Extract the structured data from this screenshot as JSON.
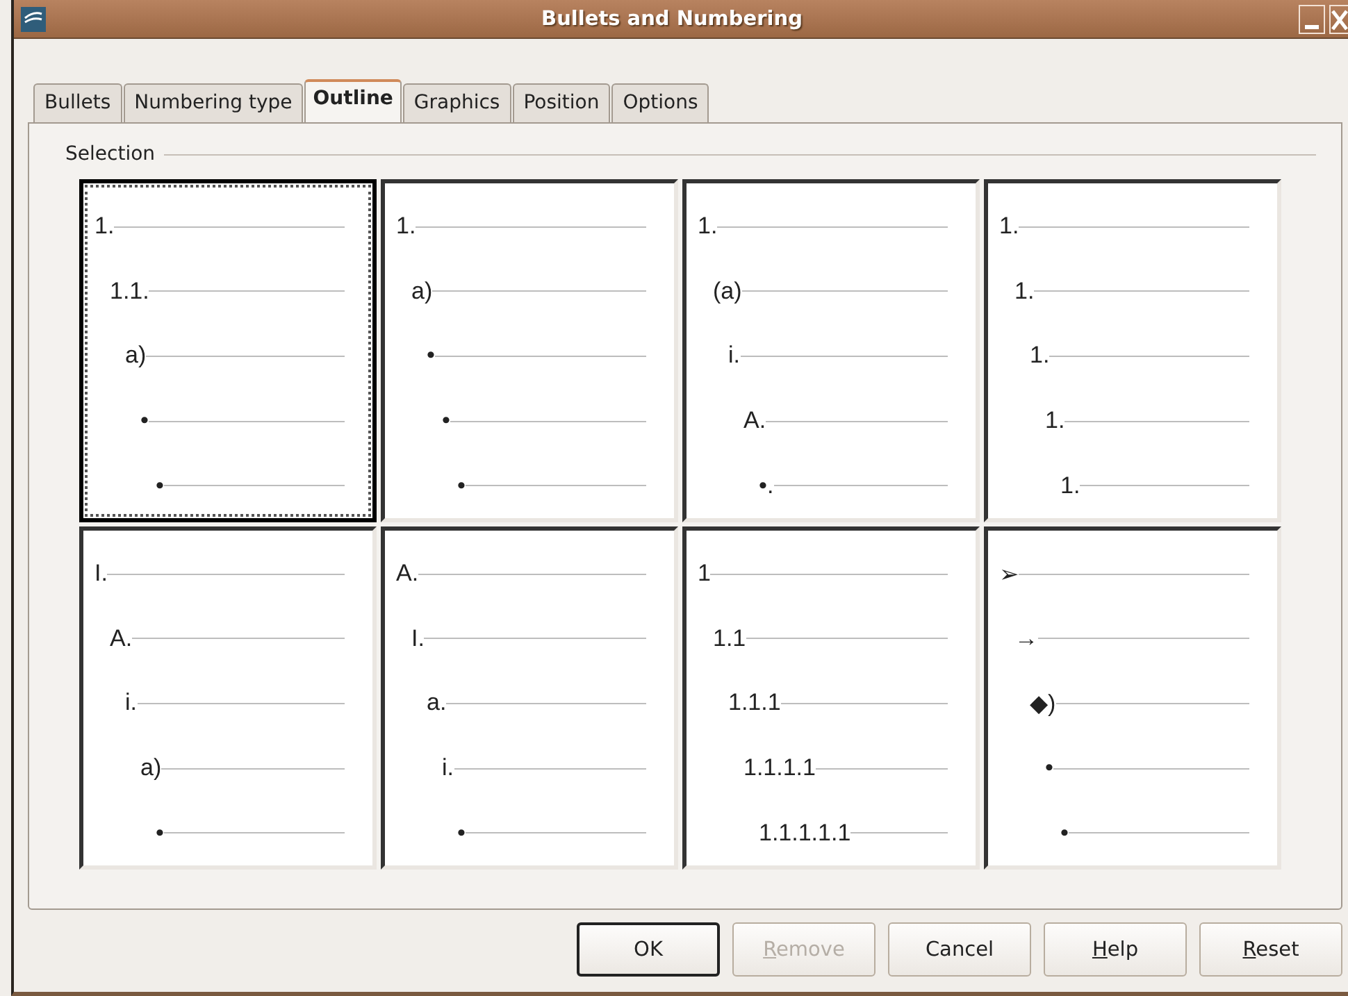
{
  "window": {
    "title": "Bullets and Numbering"
  },
  "tabs": [
    {
      "label": "Bullets",
      "selected": false
    },
    {
      "label": "Numbering type",
      "selected": false
    },
    {
      "label": "Outline",
      "selected": true
    },
    {
      "label": "Graphics",
      "selected": false
    },
    {
      "label": "Position",
      "selected": false
    },
    {
      "label": "Options",
      "selected": false
    }
  ],
  "selection": {
    "label": "Selection",
    "previews": [
      {
        "selected": true,
        "levels": [
          "1.",
          "1.1.",
          "a)",
          "•",
          "•"
        ]
      },
      {
        "selected": false,
        "levels": [
          "1.",
          "a)",
          "•",
          "•",
          "•"
        ]
      },
      {
        "selected": false,
        "levels": [
          "1.",
          "(a)",
          "i.",
          "A.",
          "•."
        ]
      },
      {
        "selected": false,
        "levels": [
          "1.",
          "1.",
          "1.",
          "1.",
          "1."
        ]
      },
      {
        "selected": false,
        "levels": [
          "I.",
          "A.",
          "i.",
          "a)",
          "•"
        ]
      },
      {
        "selected": false,
        "levels": [
          "A.",
          "I.",
          "a.",
          "i.",
          "•"
        ]
      },
      {
        "selected": false,
        "levels": [
          "1",
          "1.1",
          "1.1.1",
          "1.1.1.1",
          "1.1.1.1.1"
        ]
      },
      {
        "selected": false,
        "levels": [
          "➢",
          "→",
          "◆)",
          "•",
          "•"
        ]
      }
    ]
  },
  "buttons": [
    {
      "label": "OK",
      "mnemonic": false,
      "disabled": false,
      "default": true
    },
    {
      "label": "Remove",
      "mnemonic": true,
      "disabled": true,
      "default": false
    },
    {
      "label": "Cancel",
      "mnemonic": false,
      "disabled": false,
      "default": false
    },
    {
      "label": "Help",
      "mnemonic": true,
      "disabled": false,
      "default": false
    },
    {
      "label": "Reset",
      "mnemonic": true,
      "disabled": false,
      "default": false
    }
  ]
}
